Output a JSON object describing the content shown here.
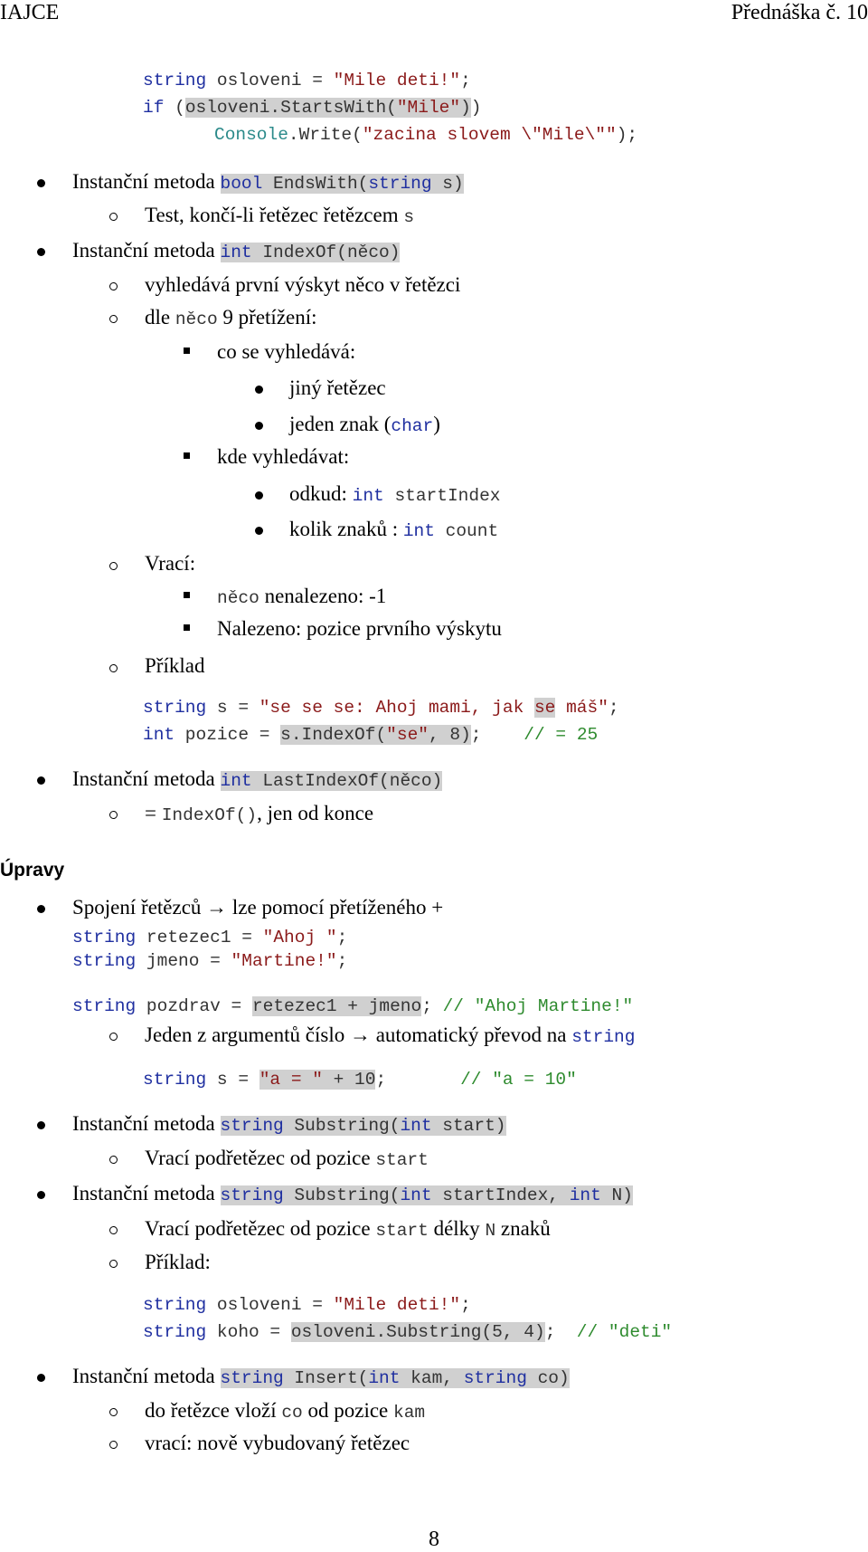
{
  "header": {
    "left": "IAJCE",
    "right": "Přednáška č. 10"
  },
  "code_startswith": {
    "l1": {
      "kw": "string",
      "rest": " osloveni = ",
      "str": "\"Mile deti!\"",
      "end": ";"
    },
    "l2": {
      "kw": "if",
      "p": " (",
      "hl_a": "osloveni.StartsWith(",
      "hl_str": "\"Mile\"",
      "hl_b": ")",
      "end": ")"
    },
    "l3": {
      "cls": "Console",
      "rest": ".Write(",
      "str": "\"zacina slovem \\\"Mile\\\"\"",
      "end": ");"
    }
  },
  "endswith": {
    "label": "Instanční metoda ",
    "sig_kw": "bool",
    "sig_a": " EndsWith(",
    "sig_kw2": "string",
    "sig_b": " s)",
    "sub": "Test, končí-li řetězec řetězcem ",
    "sub_code": "s"
  },
  "indexof": {
    "label": "Instanční metoda ",
    "sig_kw": "int",
    "sig_a": " IndexOf(něco)",
    "sub1": "vyhledává první výskyt něco v řetězci",
    "sub2_a": "dle ",
    "sub2_code": "něco",
    "sub2_b": " 9 přetížení:",
    "what": "co se vyhledává:",
    "what1": "jiný řetězec",
    "what2_a": "jeden znak (",
    "what2_code": "char",
    "what2_b": ")",
    "where": "kde vyhledávat:",
    "where1_a": "odkud: ",
    "where1_kw": "int",
    "where1_code": " startIndex",
    "where2_a": "kolik znaků : ",
    "where2_kw": "int",
    "where2_code": " count",
    "returns": "Vrací:",
    "ret1_code": "něco",
    "ret1_b": " nenalezeno: -1",
    "ret2": "Nalezeno: pozice prvního výskytu",
    "example": "Příklad",
    "ex1": {
      "kw": "string",
      "a": " s = ",
      "str_a": "\"se se se: Ahoj mami, jak ",
      "hl": "se",
      "str_b": " máš\"",
      "end": ";"
    },
    "ex2": {
      "kw": "int",
      "a": " pozice = ",
      "hl_a": "s.IndexOf(",
      "hl_str": "\"se\"",
      "hl_b": ", 8)",
      "end": ";",
      "cm": "    // = 25"
    }
  },
  "lastindexof": {
    "label": "Instanční metoda ",
    "sig_kw": "int",
    "sig_a": " LastIndexOf(něco)",
    "sub_a": "= ",
    "sub_code": "IndexOf()",
    "sub_b": ", jen od konce"
  },
  "section_title": "Úpravy",
  "concat": {
    "label": "Spojení řetězců → lze pomocí přetíženého +",
    "c1": {
      "kw": "string",
      "a": " retezec1 = ",
      "str": "\"Ahoj \"",
      "end": ";"
    },
    "c2": {
      "kw": "string",
      "a": " jmeno = ",
      "str": "\"Martine!\"",
      "end": ";"
    },
    "c3": {
      "kw": "string",
      "a": " pozdrav = ",
      "hl": "retezec1 + jmeno",
      "end": ";",
      "cm": " // \"Ahoj Martine!\""
    },
    "sub_a": "Jeden z argumentů číslo → automatický převod na ",
    "sub_code": "string",
    "c4": {
      "kw": "string",
      "a": " s = ",
      "hl_str": "\"a = \"",
      "hl_b": " + 10",
      "end": ";",
      "cm": "       // \"a = 10\""
    }
  },
  "substring1": {
    "label": "Instanční metoda ",
    "sig_kw": "string",
    "sig_a": " Substring(",
    "sig_kw2": "int",
    "sig_b": " start)",
    "sub_a": "Vrací podřetězec od pozice ",
    "sub_code": "start"
  },
  "substring2": {
    "label": "Instanční metoda ",
    "sig_kw": "string",
    "sig_a": " Substring(",
    "sig_kw2": "int",
    "sig_b": " startIndex, ",
    "sig_kw3": "int",
    "sig_c": " N)",
    "sub1_a": "Vrací podřetězec od pozice ",
    "sub1_code": "start",
    "sub1_b": " délky ",
    "sub1_code2": "N",
    "sub1_c": " znaků",
    "sub2": "Příklad:",
    "e1": {
      "kw": "string",
      "a": " osloveni = ",
      "str": "\"Mile deti!\"",
      "end": ";"
    },
    "e2": {
      "kw": "string",
      "a": " koho = ",
      "hl": "osloveni.Substring(5, 4)",
      "end": ";",
      "cm": "  // \"deti\""
    }
  },
  "insert": {
    "label": "Instanční metoda ",
    "sig_kw": "string",
    "sig_a": " Insert(",
    "sig_kw2": "int",
    "sig_b": " kam, ",
    "sig_kw3": "string",
    "sig_c": " co)",
    "sub1_a": "do řetězce vloží ",
    "sub1_code": "co",
    "sub1_b": " od pozice ",
    "sub1_code2": "kam",
    "sub2": "vrací: nově vybudovaný řetězec"
  },
  "page_number": "8"
}
